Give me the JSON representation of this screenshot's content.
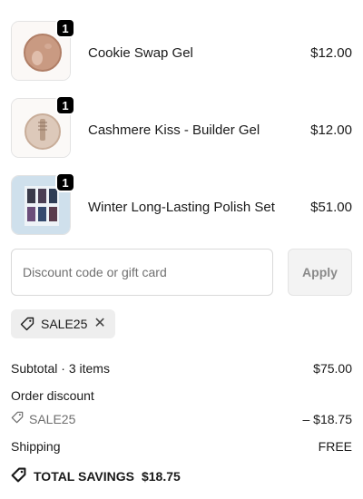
{
  "items": [
    {
      "name": "Cookie Swap Gel",
      "price": "$12.00",
      "quantity": "1"
    },
    {
      "name": "Cashmere Kiss - Builder Gel",
      "price": "$12.00",
      "quantity": "1"
    },
    {
      "name": "Winter Long-Lasting Polish Set",
      "price": "$51.00",
      "quantity": "1"
    }
  ],
  "discount": {
    "placeholder": "Discount code or gift card",
    "apply_label": "Apply",
    "applied_code": "SALE25"
  },
  "summary": {
    "subtotal_label": "Subtotal · 3 items",
    "subtotal_value": "$75.00",
    "order_discount_label": "Order discount",
    "discount_code": "SALE25",
    "discount_value": "– $18.75",
    "shipping_label": "Shipping",
    "shipping_value": "FREE",
    "total_savings_label": "TOTAL SAVINGS",
    "total_savings_value": "$18.75"
  },
  "icons": {
    "tag": "tag-icon",
    "remove": "close-icon"
  },
  "colors": {
    "badge": "#000000",
    "chip_bg": "#eeeeee",
    "apply_bg": "#f3f3f3"
  }
}
